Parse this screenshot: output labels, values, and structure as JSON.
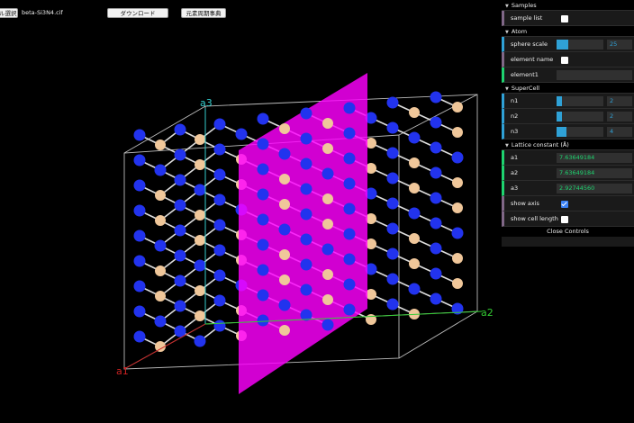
{
  "toolbar": {
    "file_select_label": "ル選択",
    "file_name": "beta-Si3N4.cif",
    "download_label": "ダウンロード",
    "periodic_table_label": "元素周期事典"
  },
  "axes": {
    "a1": "a1",
    "a2": "a2",
    "a3": "a3"
  },
  "colors": {
    "background": "#000000",
    "nitrogen_atom": "#2233ee",
    "silicon_atom": "#f0c79a",
    "plane": "#ff00ff",
    "axis_a1": "#cc2222",
    "axis_a2": "#33cc33",
    "axis_a3": "#33cccc"
  },
  "panel": {
    "samples": {
      "title": "Samples",
      "sample_list_label": "sample list",
      "sample_list_checked": false
    },
    "atom": {
      "title": "Atom",
      "sphere_scale_label": "sphere scale",
      "sphere_scale_value": "25",
      "sphere_scale_fraction": 0.25,
      "element_name_label": "element name",
      "element_name_checked": false,
      "element1_label": "element1",
      "element1_value": ""
    },
    "supercell": {
      "title": "SuperCell",
      "n1_label": "n1",
      "n1_value": "2",
      "n1_fraction": 0.12,
      "n2_label": "n2",
      "n2_value": "2",
      "n2_fraction": 0.12,
      "n3_label": "n3",
      "n3_value": "4",
      "n3_fraction": 0.22
    },
    "lattice": {
      "title": "Lattice constant (Å)",
      "a1_label": "a1",
      "a1_value": "7.63649184",
      "a2_label": "a2",
      "a2_value": "7.63649184",
      "a3_label": "a3",
      "a3_value": "2.92744560",
      "show_axis_label": "show axis",
      "show_axis_checked": true,
      "show_cell_length_label": "show cell length",
      "show_cell_length_checked": false
    },
    "close_controls_label": "Close Controls"
  }
}
